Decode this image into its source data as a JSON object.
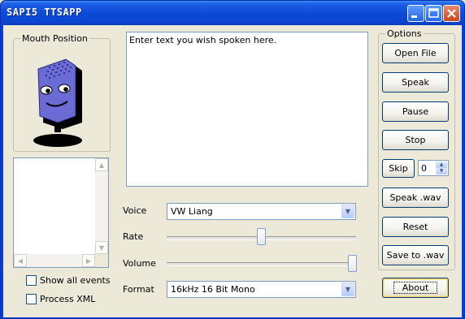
{
  "window": {
    "title": "SAPI5 TTSAPP"
  },
  "mouth_group": {
    "label": "Mouth Position"
  },
  "text_area": {
    "value": "Enter text you wish spoken here."
  },
  "voice": {
    "label": "Voice",
    "selected": "VW Liang"
  },
  "rate": {
    "label": "Rate",
    "level": 0.5
  },
  "volume": {
    "label": "Volume",
    "level": 1.0
  },
  "format": {
    "label": "Format",
    "selected": "16kHz 16 Bit Mono"
  },
  "options": {
    "label": "Options",
    "buttons": {
      "open_file": "Open File",
      "speak": "Speak",
      "pause": "Pause",
      "stop": "Stop",
      "skip": "Skip",
      "speak_wav": "Speak .wav",
      "reset": "Reset",
      "save_to_wav": "Save to .wav"
    },
    "skip_value": "0"
  },
  "about_button": "About",
  "checkboxes": {
    "show_all_events": {
      "label": "Show all events",
      "checked": false
    },
    "process_xml": {
      "label": "Process XML",
      "checked": false
    }
  },
  "colors": {
    "title_bar": "#0a46d0",
    "face_purple": "#6b6bd6",
    "window_bg": "#ece9d8"
  },
  "icons": [
    "minimize-icon",
    "maximize-icon",
    "close-icon",
    "microphone-face-icon",
    "dropdown-arrow-icon",
    "spin-up-icon",
    "spin-down-icon",
    "scroll-arrow-icon"
  ]
}
